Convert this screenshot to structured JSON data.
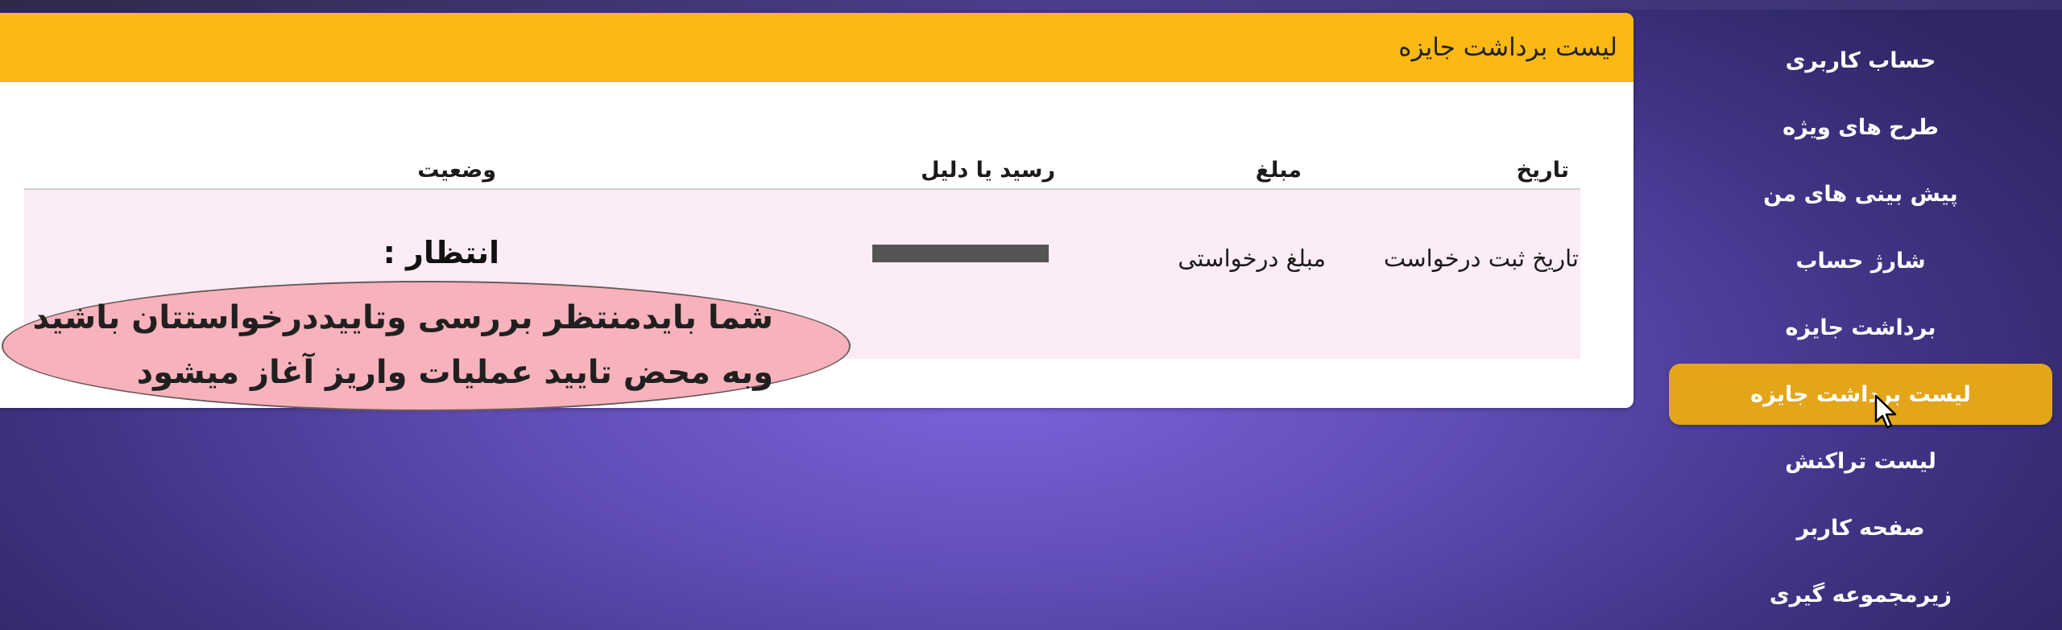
{
  "sidebar": {
    "items": [
      {
        "label": "حساب کاربری",
        "active": false
      },
      {
        "label": "طرح های ویژه",
        "active": false
      },
      {
        "label": "پیش بینی های من",
        "active": false
      },
      {
        "label": "شارژ حساب",
        "active": false
      },
      {
        "label": "برداشت جایزه",
        "active": false
      },
      {
        "label": "لیست برداشت جایزه",
        "active": true
      },
      {
        "label": "لیست تراکنش",
        "active": false
      },
      {
        "label": "صفحه کاربر",
        "active": false
      },
      {
        "label": "زیرمجموعه گیری",
        "active": false
      }
    ]
  },
  "card": {
    "title": "لیست برداشت جایزه",
    "columns": {
      "date": "تاریخ",
      "amount": "مبلغ",
      "receipt": "رسید یا دلیل",
      "status": "وضعیت"
    },
    "row": {
      "date": "تاریخ ثبت درخواست",
      "amount": "مبلغ  درخواستی",
      "status": "انتظار :"
    }
  },
  "callout": {
    "line1": "شما بایدمنتظر بررسی وتاییددرخواستتان باشید",
    "line2": "وبه محض تایید عملیات واریز آغاز میشود"
  },
  "colors": {
    "header": "#fcb813",
    "active_nav": "#e3a51a",
    "row_bg": "#fbecf6",
    "callout_bg": "#f7b2bc"
  },
  "icons": {
    "cursor": "mouse-pointer-icon"
  }
}
